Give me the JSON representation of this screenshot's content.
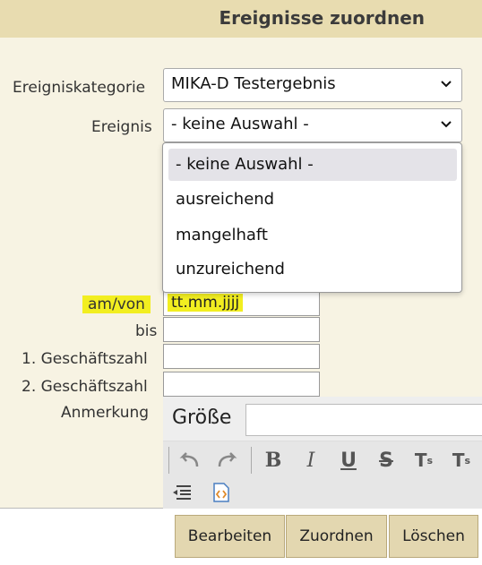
{
  "header": {
    "title": "Ereignisse zuordnen"
  },
  "form": {
    "kategorie_label": "Ereigniskategorie",
    "kategorie_value": "MIKA-D Testergebnis",
    "ereignis_label": "Ereignis",
    "ereignis_value": "- keine Auswahl -",
    "ereignis_options": [
      "- keine Auswahl -",
      "ausreichend",
      "mangelhaft",
      "unzureichend"
    ],
    "amvon_label": "am/von",
    "amvon_placeholder": "tt.mm.jjjj",
    "bis_label": "bis",
    "gz1_label": "1. Geschäftszahl",
    "gz2_label": "2. Geschäftszahl",
    "anmerkung_label": "Anmerkung"
  },
  "editor": {
    "size_label": "Größe",
    "tools": [
      "undo-icon",
      "redo-icon",
      "bold-icon",
      "italic-icon",
      "underline-icon",
      "strikethrough-icon",
      "subscript-icon",
      "superscript-icon",
      "outdent-icon",
      "source-icon"
    ]
  },
  "buttons": {
    "bearbeiten": "Bearbeiten",
    "zuordnen": "Zuordnen",
    "loeschen": "Löschen"
  }
}
